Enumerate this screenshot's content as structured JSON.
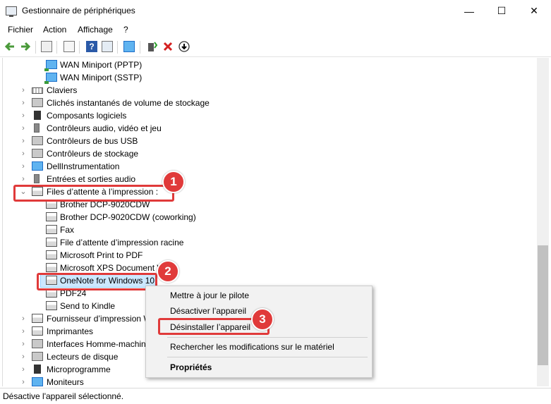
{
  "window": {
    "title": "Gestionnaire de périphériques",
    "minimize": "—",
    "maximize": "☐",
    "close": "✕"
  },
  "menu": [
    "Fichier",
    "Action",
    "Affichage",
    "?"
  ],
  "tree": {
    "network_items": [
      "WAN Miniport (PPTP)",
      "WAN Miniport (SSTP)"
    ],
    "categories_top": [
      "Claviers",
      "Clichés instantanés de volume de stockage",
      "Composants logiciels",
      "Contrôleurs audio, vidéo et jeu",
      "Contrôleurs de bus USB",
      "Contrôleurs de stockage",
      "DellInstrumentation",
      "Entrées et sorties audio"
    ],
    "expanded_category": "Files d’attente à l’impression :",
    "printer_items": [
      "Brother DCP-9020CDW",
      "Brother DCP-9020CDW (coworking)",
      "Fax",
      "File d’attente d’impression racine",
      "Microsoft Print to PDF",
      "Microsoft XPS Document W",
      "OneNote for Windows 10",
      "PDF24",
      "Send to Kindle"
    ],
    "categories_bottom": [
      "Fournisseur d’impression W",
      "Imprimantes",
      "Interfaces Homme-machin",
      "Lecteurs de disque",
      "Microprogramme",
      "Moniteurs"
    ]
  },
  "context_menu": {
    "items": [
      "Mettre à jour le pilote",
      "Désactiver l’appareil",
      "Désinstaller l’appareil",
      "Rechercher les modifications sur le matériel",
      "Propriétés"
    ]
  },
  "badges": [
    "1",
    "2",
    "3"
  ],
  "status_bar": "Désactive l'appareil sélectionné.",
  "colors": {
    "annotation": "#e03a3a",
    "selection": "#cce8ff"
  }
}
